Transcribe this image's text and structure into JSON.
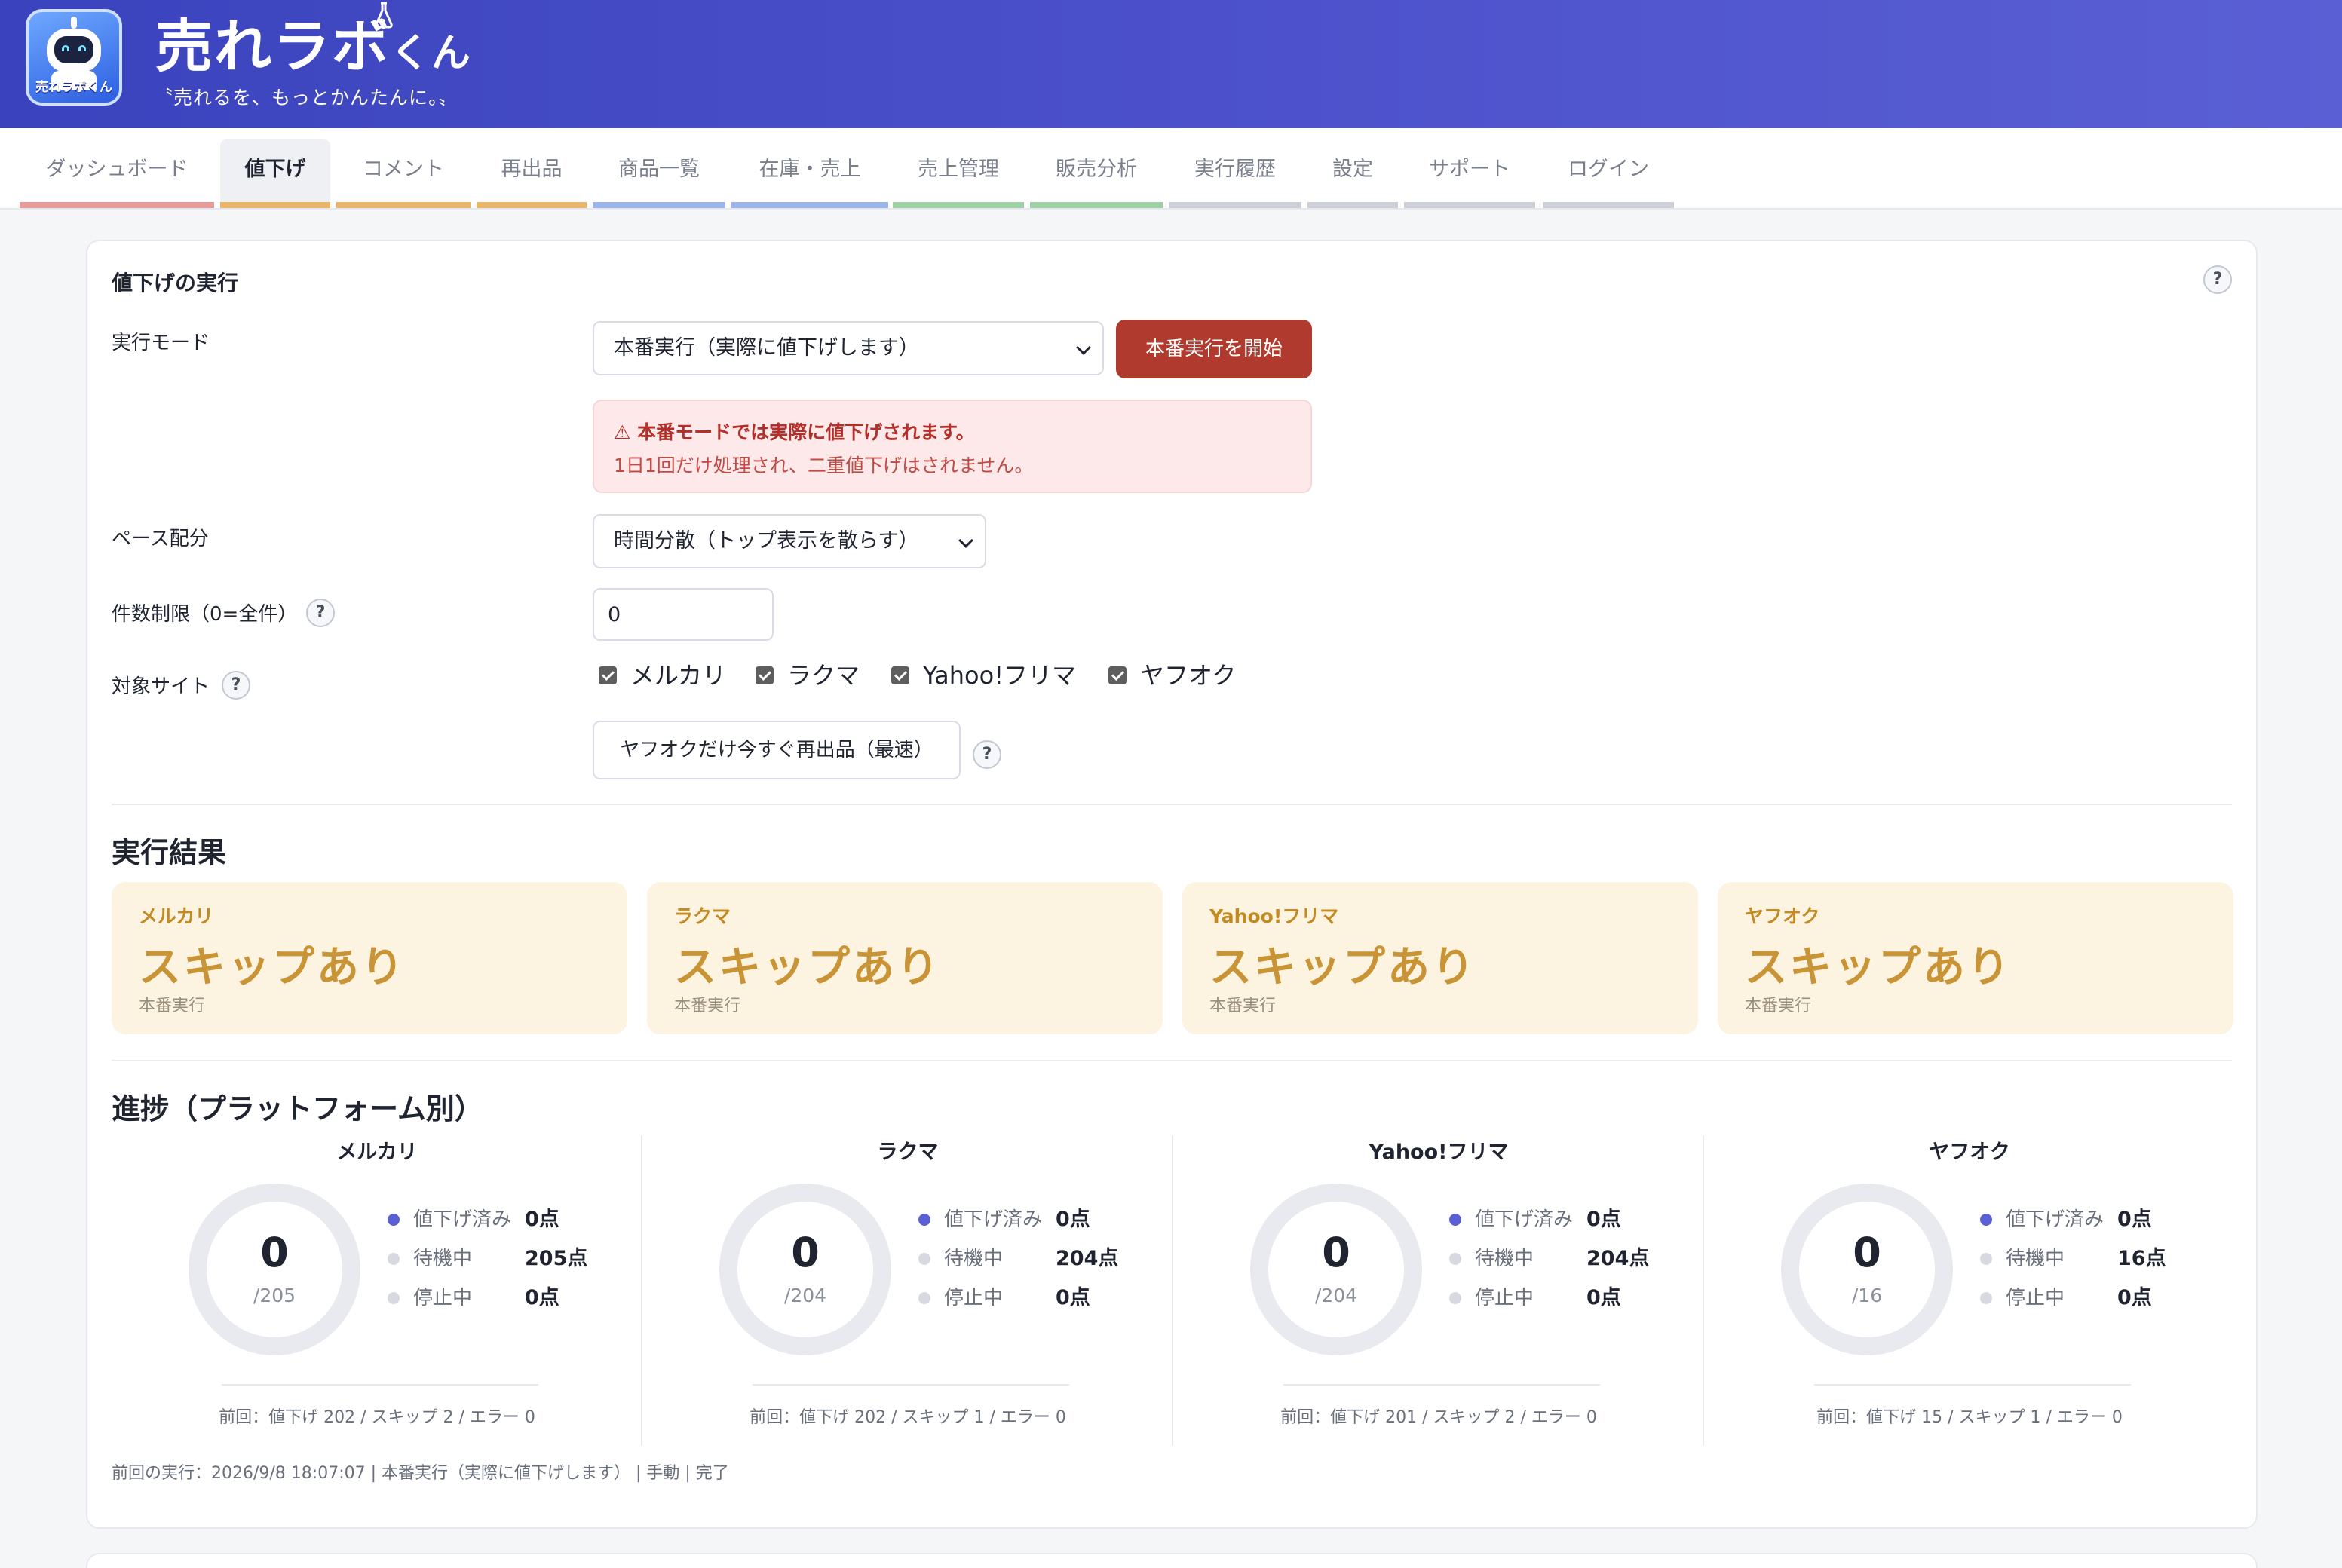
{
  "header": {
    "logo_label": "売れラボくん",
    "title_main": "売れラボ",
    "title_sub": "くん",
    "tagline": "〝売れるを、もっとかんたんに。〟"
  },
  "tabs": [
    {
      "label": "ダッシュボード",
      "color": "#e79a9a"
    },
    {
      "label": "値下げ",
      "color": "#e8b56a",
      "active": true
    },
    {
      "label": "コメント",
      "color": "#e8b56a"
    },
    {
      "label": "再出品",
      "color": "#e8b56a"
    },
    {
      "label": "商品一覧",
      "color": "#9cb5e8"
    },
    {
      "label": "在庫・売上",
      "color": "#9cb5e8"
    },
    {
      "label": "売上管理",
      "color": "#9fd0a6"
    },
    {
      "label": "販売分析",
      "color": "#9fd0a6"
    },
    {
      "label": "実行履歴",
      "color": "#cdd0d8"
    },
    {
      "label": "設定",
      "color": "#cdd0d8"
    },
    {
      "label": "サポート",
      "color": "#cdd0d8"
    },
    {
      "label": "ログイン",
      "color": "#cdd0d8"
    }
  ],
  "execute": {
    "title": "値下げの実行",
    "help": "?",
    "mode_label": "実行モード",
    "mode_value": "本番実行（実際に値下げします）",
    "start_button": "本番実行を開始",
    "warning_title": "⚠ 本番モードでは実際に値下げされます。",
    "warning_body": "1日1回だけ処理され、二重値下げはされません。",
    "pace_label": "ペース配分",
    "pace_value": "時間分散（トップ表示を散らす）",
    "limit_label": "件数制限（0=全件）",
    "limit_value": "0",
    "sites_label": "対象サイト",
    "sites": [
      "メルカリ",
      "ラクマ",
      "Yahoo!フリマ",
      "ヤフオク"
    ],
    "relist_button": "ヤフオクだけ今すぐ再出品（最速）"
  },
  "results": {
    "heading": "実行結果",
    "items": [
      {
        "platform": "メルカリ",
        "status": "スキップあり",
        "mode": "本番実行"
      },
      {
        "platform": "ラクマ",
        "status": "スキップあり",
        "mode": "本番実行"
      },
      {
        "platform": "Yahoo!フリマ",
        "status": "スキップあり",
        "mode": "本番実行"
      },
      {
        "platform": "ヤフオク",
        "status": "スキップあり",
        "mode": "本番実行"
      }
    ]
  },
  "progress": {
    "heading": "進捗（プラットフォーム別）",
    "legend_keys": [
      "値下げ済み",
      "待機中",
      "停止中"
    ],
    "legend_colors": [
      "#5a5fd4",
      "#d6d9e0",
      "#d6d9e0"
    ],
    "ring_color": "#e9eaef",
    "platforms": [
      {
        "name": "メルカリ",
        "done": "0",
        "total": "/205",
        "values": [
          "0点",
          "205点",
          "0点"
        ],
        "prev": "前回：値下げ 202 / スキップ 2 / エラー 0"
      },
      {
        "name": "ラクマ",
        "done": "0",
        "total": "/204",
        "values": [
          "0点",
          "204点",
          "0点"
        ],
        "prev": "前回：値下げ 202 / スキップ 1 / エラー 0"
      },
      {
        "name": "Yahoo!フリマ",
        "done": "0",
        "total": "/204",
        "values": [
          "0点",
          "204点",
          "0点"
        ],
        "prev": "前回：値下げ 201 / スキップ 2 / エラー 0"
      },
      {
        "name": "ヤフオク",
        "done": "0",
        "total": "/16",
        "values": [
          "0点",
          "16点",
          "0点"
        ],
        "prev": "前回：値下げ 15 / スキップ 1 / エラー 0"
      }
    ],
    "last_run": "前回の実行：2026/9/8 18:07:07 | 本番実行（実際に値下げします） | 手動 | 完了"
  }
}
